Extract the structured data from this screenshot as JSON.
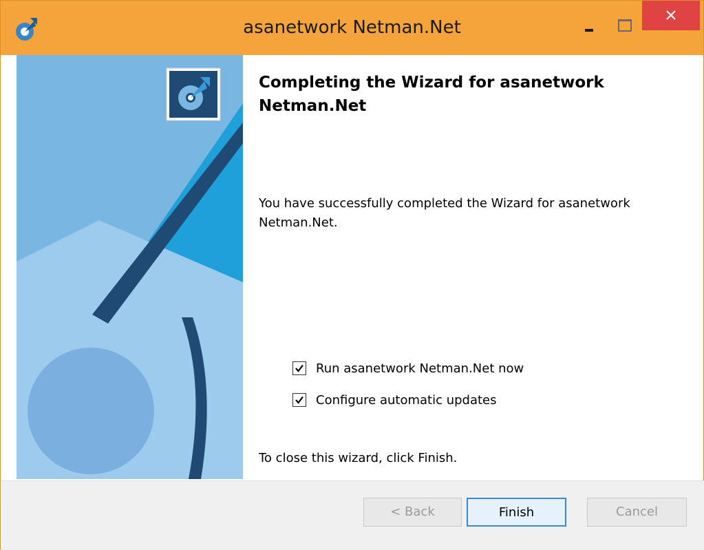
{
  "window": {
    "title": "asanetwork Netman.Net",
    "accent_color": "#f5a33b",
    "close_color": "#e04343"
  },
  "icons": {
    "app": "netman-logo-icon",
    "minimize": "minimize-icon",
    "maximize": "maximize-icon",
    "close": "close-icon",
    "checkbox": "checkmark-icon"
  },
  "wizard": {
    "heading": "Completing the Wizard for asanetwork Netman.Net",
    "message": "You have successfully completed the Wizard for asanetwork Netman.Net.",
    "options": [
      {
        "label": "Run asanetwork Netman.Net now",
        "checked": true
      },
      {
        "label": "Configure automatic updates",
        "checked": true
      }
    ],
    "footer": "To close this wizard, click Finish."
  },
  "buttons": {
    "back": "< Back",
    "finish": "Finish",
    "cancel": "Cancel"
  }
}
